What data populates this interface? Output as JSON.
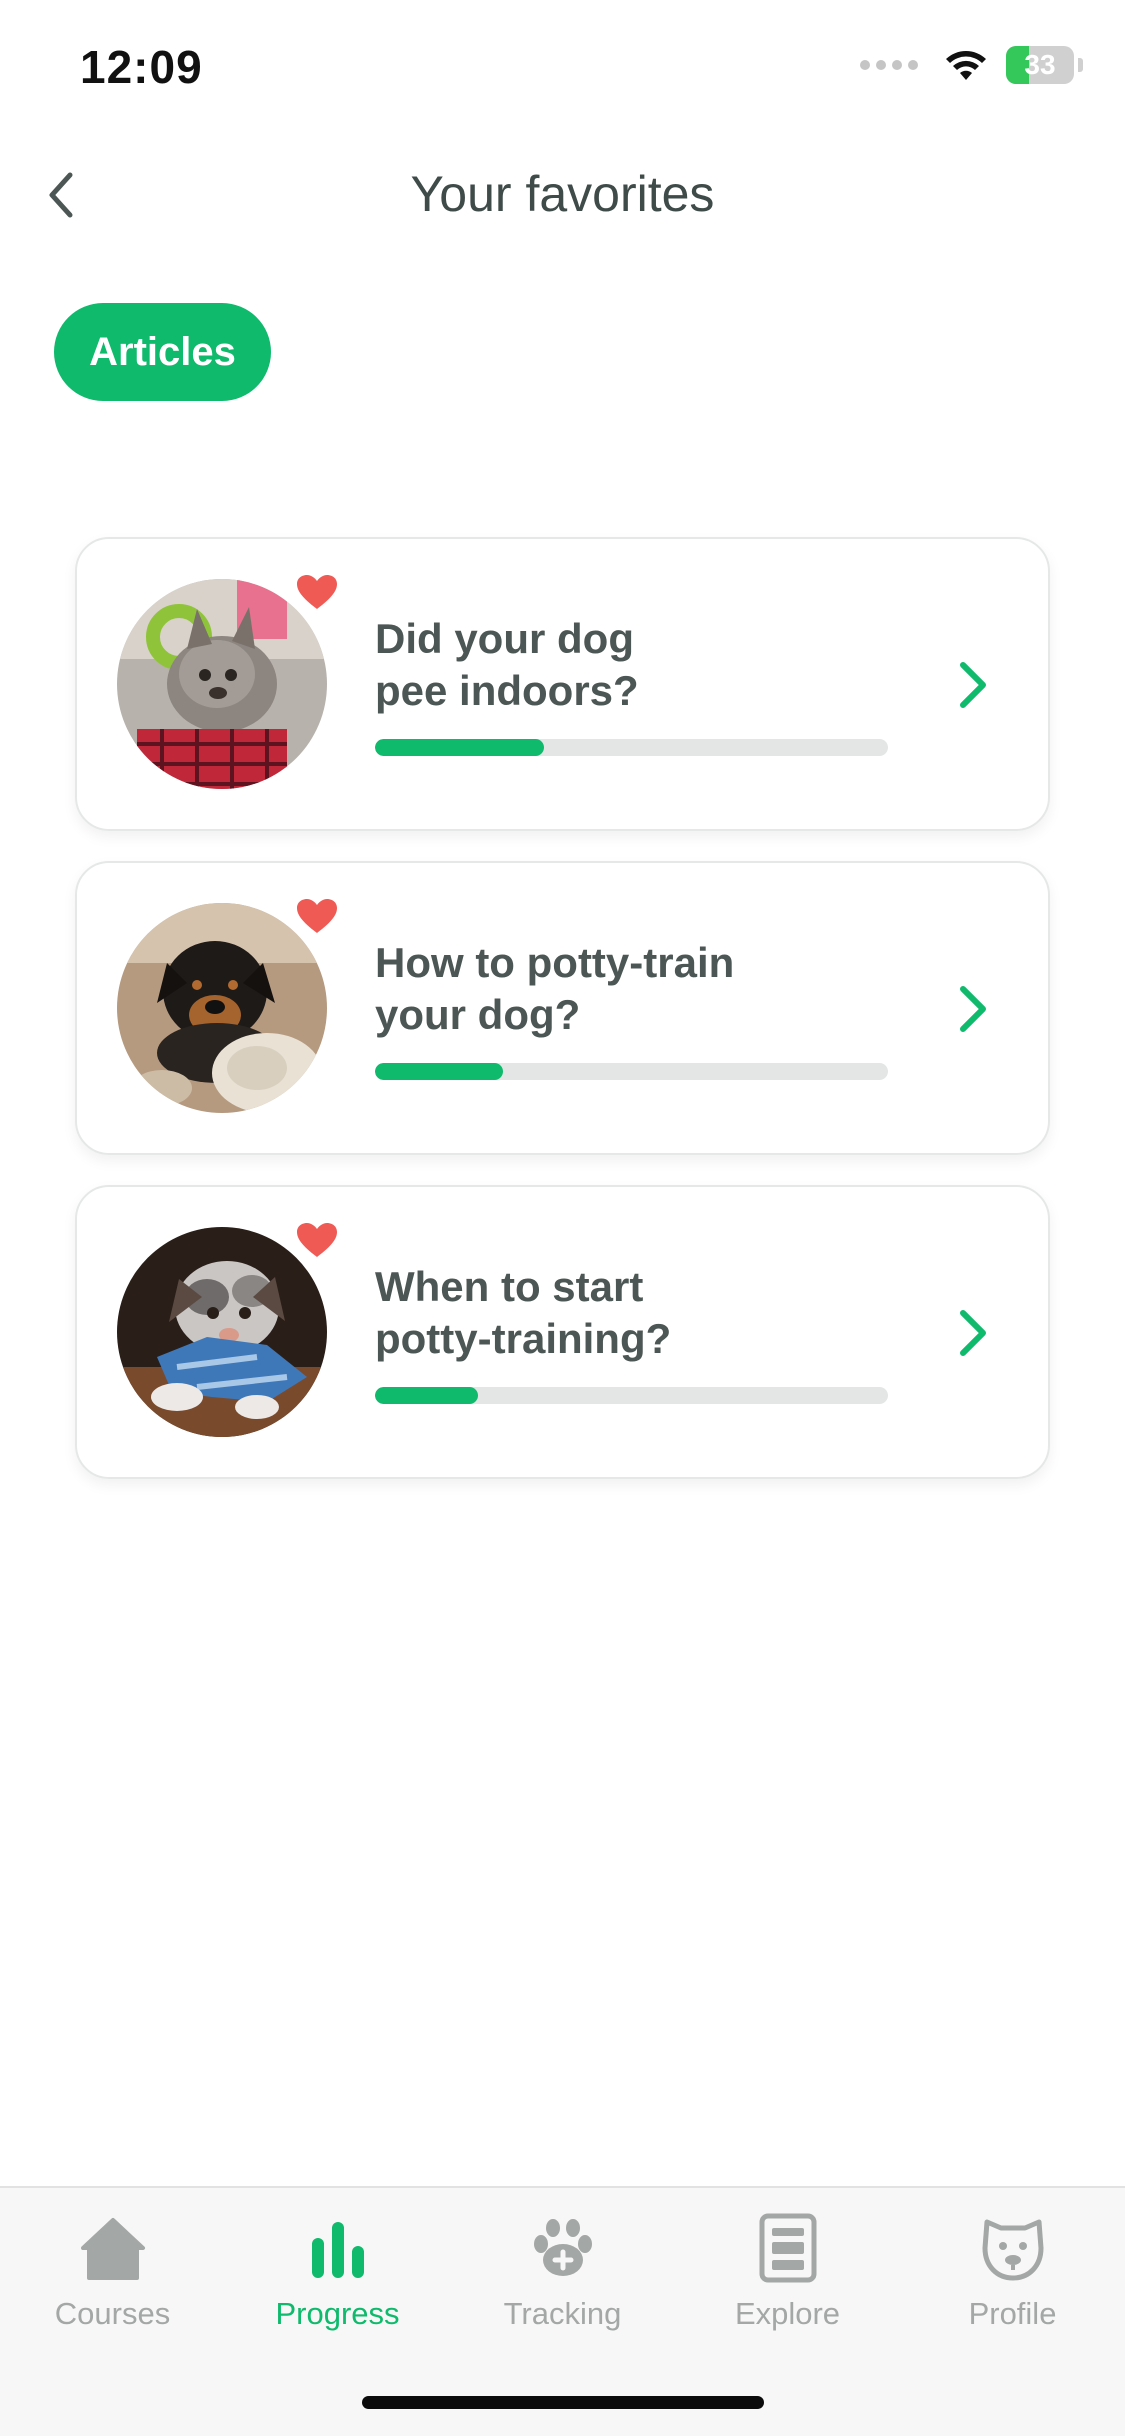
{
  "status_bar": {
    "time": "12:09",
    "battery": "33"
  },
  "header": {
    "title": "Your favorites"
  },
  "filter": {
    "label": "Articles"
  },
  "articles": [
    {
      "title": "Did your dog\npee indoors?",
      "progress": 0.33,
      "favorite": true,
      "image": "french-bulldog-puppy-photo"
    },
    {
      "title": "How to potty-train\nyour dog?",
      "progress": 0.25,
      "favorite": true,
      "image": "rottweiler-puppy-photo"
    },
    {
      "title": "When to start\npotty-training?",
      "progress": 0.2,
      "favorite": true,
      "image": "australian-shepherd-puppy-photo"
    }
  ],
  "tab_bar": {
    "items": [
      {
        "label": "Courses",
        "icon": "house-icon",
        "active": false
      },
      {
        "label": "Progress",
        "icon": "bar-chart-icon",
        "active": true
      },
      {
        "label": "Tracking",
        "icon": "paw-plus-icon",
        "active": false
      },
      {
        "label": "Explore",
        "icon": "document-icon",
        "active": false
      },
      {
        "label": "Profile",
        "icon": "dog-face-icon",
        "active": false
      }
    ]
  },
  "colors": {
    "accent": "#0fba6c",
    "heart": "#f05a55",
    "text": "#3f4b49",
    "inactive": "#a3a7a6"
  }
}
